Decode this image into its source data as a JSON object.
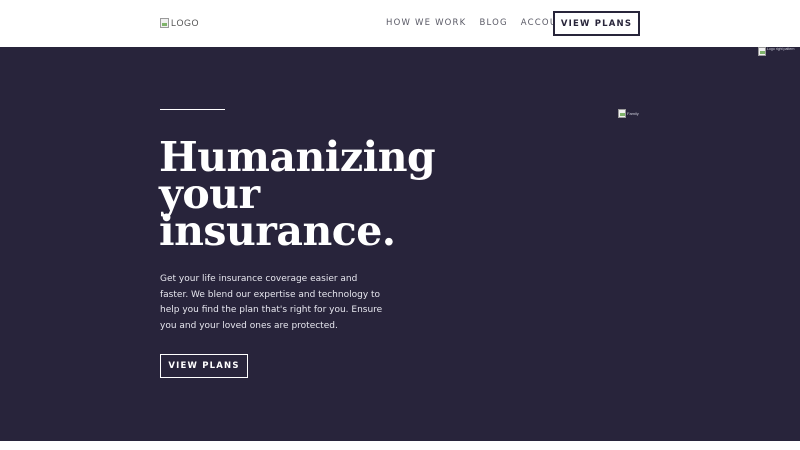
{
  "header": {
    "logo_alt": "LOGO",
    "nav": [
      {
        "label": "HOW WE WORK"
      },
      {
        "label": "BLOG"
      },
      {
        "label": "ACCOUNT"
      }
    ],
    "cta_label": "VIEW PLANS"
  },
  "hero": {
    "title_lines": [
      "Humanizing",
      "your",
      "insurance."
    ],
    "body": "Get your life insurance coverage easier and faster. We blend our expertise and technology to help you find the plan that's right for you. Ensure you and your loved ones are protected.",
    "cta_label": "VIEW PLANS",
    "family_image_alt": "Family",
    "corner_image_alt": "Logo right pattern"
  },
  "colors": {
    "hero_bg": "#28243b",
    "text_light": "#ffffff",
    "nav_text": "#5a5a66"
  }
}
